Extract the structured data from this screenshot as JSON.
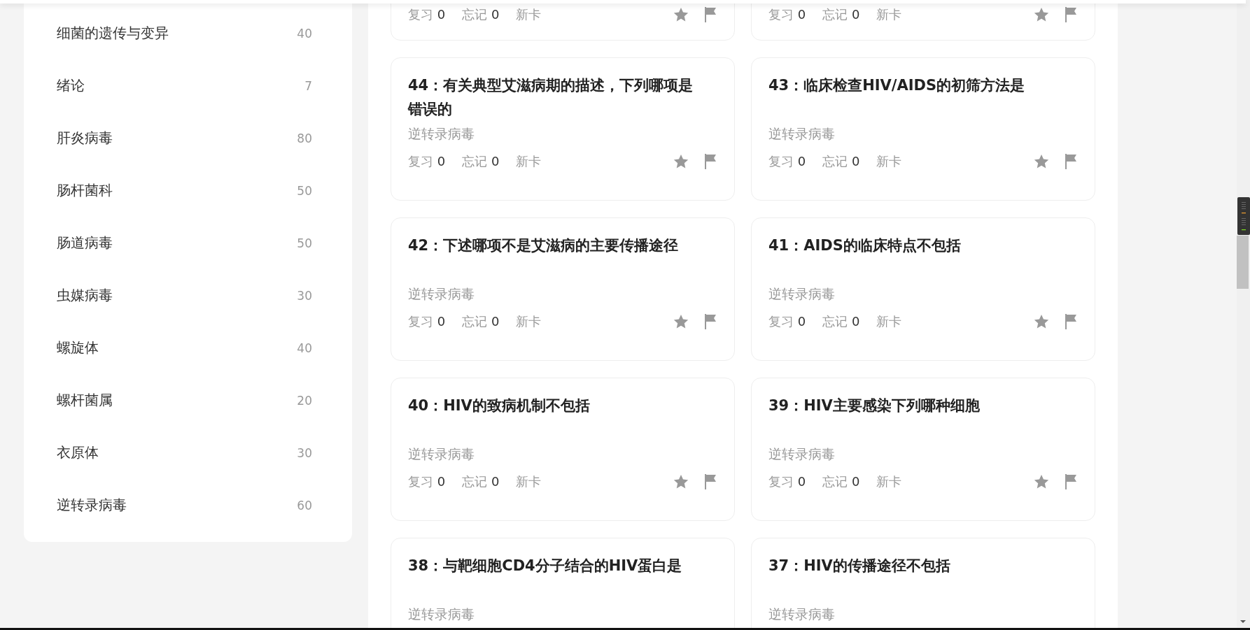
{
  "sidebar": {
    "items": [
      {
        "label": "细菌的遗传与变异",
        "count": "40"
      },
      {
        "label": "绪论",
        "count": "7"
      },
      {
        "label": "肝炎病毒",
        "count": "80"
      },
      {
        "label": "肠杆菌科",
        "count": "50"
      },
      {
        "label": "肠道病毒",
        "count": "50"
      },
      {
        "label": "虫媒病毒",
        "count": "30"
      },
      {
        "label": "螺旋体",
        "count": "40"
      },
      {
        "label": "螺杆菌属",
        "count": "20"
      },
      {
        "label": "衣原体",
        "count": "30"
      },
      {
        "label": "逆转录病毒",
        "count": "60"
      }
    ]
  },
  "cards": [
    {
      "review_label": "复习",
      "review": "0",
      "forget_label": "忘记",
      "forget": "0",
      "new_label": "新卡"
    },
    {
      "review_label": "复习",
      "review": "0",
      "forget_label": "忘记",
      "forget": "0",
      "new_label": "新卡"
    },
    {
      "title": "44：有关典型艾滋病期的描述，下列哪项是错误的",
      "category": "逆转录病毒",
      "review_label": "复习",
      "review": "0",
      "forget_label": "忘记",
      "forget": "0",
      "new_label": "新卡"
    },
    {
      "title": "43：临床检查HIV/AIDS的初筛方法是",
      "category": "逆转录病毒",
      "review_label": "复习",
      "review": "0",
      "forget_label": "忘记",
      "forget": "0",
      "new_label": "新卡"
    },
    {
      "title": "42：下述哪项不是艾滋病的主要传播途径",
      "category": "逆转录病毒",
      "review_label": "复习",
      "review": "0",
      "forget_label": "忘记",
      "forget": "0",
      "new_label": "新卡"
    },
    {
      "title": "41：AIDS的临床特点不包括",
      "category": "逆转录病毒",
      "review_label": "复习",
      "review": "0",
      "forget_label": "忘记",
      "forget": "0",
      "new_label": "新卡"
    },
    {
      "title": "40：HIV的致病机制不包括",
      "category": "逆转录病毒",
      "review_label": "复习",
      "review": "0",
      "forget_label": "忘记",
      "forget": "0",
      "new_label": "新卡"
    },
    {
      "title": "39：HIV主要感染下列哪种细胞",
      "category": "逆转录病毒",
      "review_label": "复习",
      "review": "0",
      "forget_label": "忘记",
      "forget": "0",
      "new_label": "新卡"
    },
    {
      "title": "38：与靶细胞CD4分子结合的HIV蛋白是",
      "category": "逆转录病毒"
    },
    {
      "title": "37：HIV的传播途径不包括",
      "category": "逆转录病毒"
    }
  ]
}
